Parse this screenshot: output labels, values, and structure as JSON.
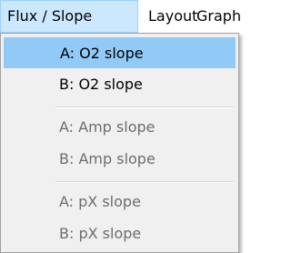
{
  "menubar": {
    "items": [
      {
        "label": "Flux / Slope",
        "active": true
      },
      {
        "label": "Layout"
      },
      {
        "label": "Graph"
      }
    ]
  },
  "dropdown": {
    "items": [
      {
        "label": "A: O2 slope",
        "enabled": true,
        "highlighted": true
      },
      {
        "label": "B: O2 slope",
        "enabled": true
      },
      {
        "separator": true
      },
      {
        "label": "A: Amp slope",
        "enabled": false
      },
      {
        "label": "B: Amp slope",
        "enabled": false
      },
      {
        "separator": true
      },
      {
        "label": "A: pX slope",
        "enabled": false
      },
      {
        "label": "B: pX slope",
        "enabled": false
      }
    ]
  }
}
